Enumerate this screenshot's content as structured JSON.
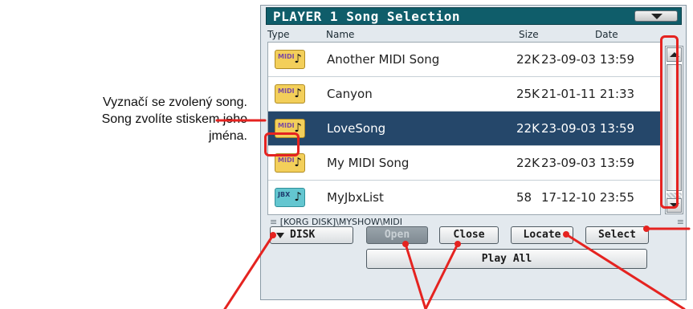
{
  "annotation": {
    "lines": [
      "Vyznačí se zvolený song.",
      "Song zvolíte stiskem jeho",
      "jména."
    ]
  },
  "window": {
    "title": "PLAYER 1 Song Selection",
    "menu_icon": "triangle-down-icon"
  },
  "columns": {
    "type": "Type",
    "name": "Name",
    "size": "Size",
    "date": "Date"
  },
  "files": [
    {
      "icon_label": "MIDI",
      "icon": "midi-file-icon",
      "name": "Another MIDI Song",
      "size": "22K",
      "date": "23-09-03 13:59",
      "selected": false
    },
    {
      "icon_label": "MIDI",
      "icon": "midi-file-icon",
      "name": "Canyon",
      "size": "25K",
      "date": "21-01-11 21:33",
      "selected": false
    },
    {
      "icon_label": "MIDI",
      "icon": "midi-file-icon",
      "name": "LoveSong",
      "size": "22K",
      "date": "23-09-03 13:59",
      "selected": true
    },
    {
      "icon_label": "MIDI",
      "icon": "midi-file-icon",
      "name": "My MIDI Song",
      "size": "22K",
      "date": "23-09-03 13:59",
      "selected": false
    },
    {
      "icon_label": "JBX",
      "icon": "jbx-file-icon",
      "name": "MyJbxList",
      "size": "58",
      "date": "17-12-10 23:55",
      "selected": false
    }
  ],
  "path": "[KORG DISK]\\MYSHOW\\MIDI",
  "buttons": {
    "disk": "DISK",
    "open": "Open",
    "close": "Close",
    "locate": "Locate",
    "select": "Select",
    "play_all": "Play All"
  },
  "colors": {
    "title_bar": "#0f5d6a",
    "selected_row": "#25476a",
    "highlight": "#e52320",
    "midi_icon": "#f3cf5a",
    "jbx_icon": "#63c6d0"
  }
}
